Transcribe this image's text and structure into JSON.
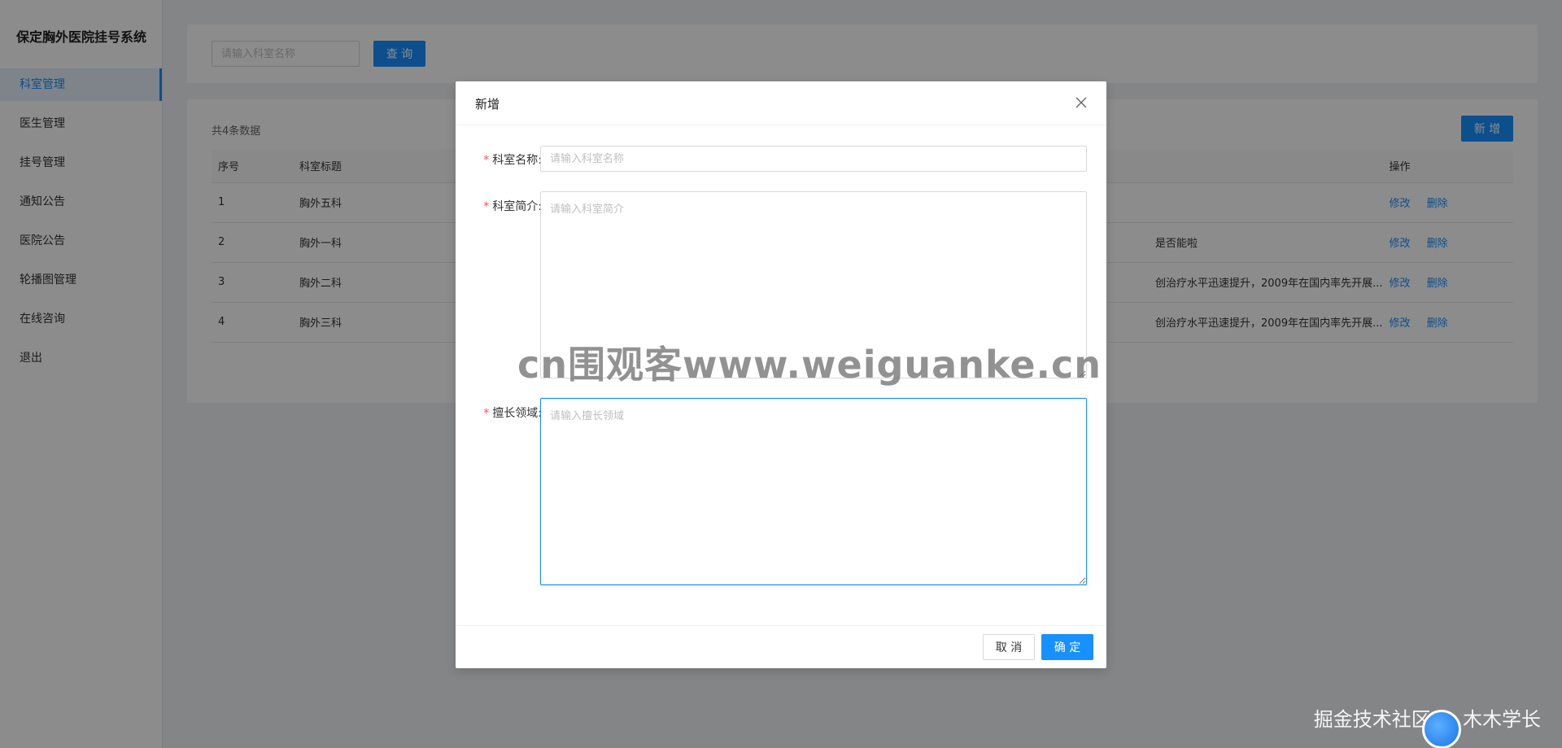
{
  "app": {
    "title": "保定胸外医院挂号系统"
  },
  "sidebar": {
    "items": [
      {
        "label": "科室管理",
        "active": true
      },
      {
        "label": "医生管理"
      },
      {
        "label": "挂号管理"
      },
      {
        "label": "通知公告"
      },
      {
        "label": "医院公告"
      },
      {
        "label": "轮播图管理"
      },
      {
        "label": "在线咨询"
      },
      {
        "label": "退出"
      }
    ]
  },
  "search": {
    "placeholder": "请输入科室名称",
    "button_label": "查 询"
  },
  "table": {
    "count_text": "共4条数据",
    "add_label": "新 增",
    "columns": [
      "序号",
      "科室标题",
      "",
      "操作"
    ],
    "rows": [
      {
        "index": "1",
        "title": "胸外五科",
        "tail": ""
      },
      {
        "index": "2",
        "title": "胸外一科",
        "tail": "是否能啦"
      },
      {
        "index": "3",
        "title": "胸外二科",
        "tail": "创治疗水平迅速提升，2009年在国内率先开展..."
      },
      {
        "index": "4",
        "title": "胸外三科",
        "tail": "创治疗水平迅速提升，2009年在国内率先开展..."
      }
    ],
    "edit_label": "修改",
    "delete_label": "删除"
  },
  "modal": {
    "title": "新增",
    "fields": [
      {
        "label": "科室名称:",
        "placeholder": "请输入科室名称"
      },
      {
        "label": "科室简介:",
        "placeholder": "请输入科室简介"
      },
      {
        "label": "擅长领域:",
        "placeholder": "请输入擅长领域"
      }
    ],
    "required_mark": "*",
    "cancel_label": "取 消",
    "ok_label": "确 定"
  },
  "watermarks": {
    "center": "cn围观客www.weiguanke.cn",
    "corner": "掘金技术社区 @ 木木学长"
  },
  "colors": {
    "primary": "#1890ff",
    "danger": "#ff4d4f"
  }
}
